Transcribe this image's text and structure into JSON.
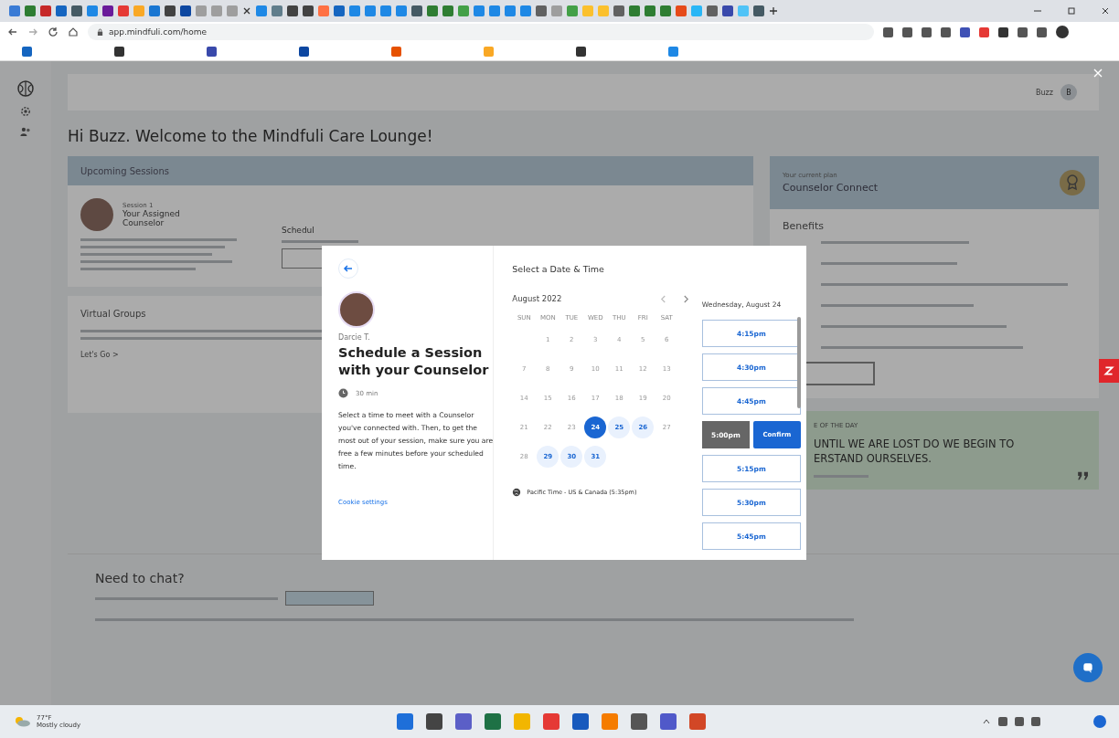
{
  "browser": {
    "address": "app.mindfuli.com/home"
  },
  "page": {
    "user": {
      "name": "Buzz",
      "initial": "B"
    },
    "greeting": "Hi Buzz. Welcome to the Mindfuli Care Lounge!",
    "upcoming": {
      "title": "Upcoming Sessions",
      "session_label": "Session 1",
      "counselor_title": "Your Assigned Counselor",
      "schedule_label": "Schedul"
    },
    "groups": {
      "title": "Virtual Groups",
      "link": "Let's Go >"
    },
    "plan": {
      "label": "Your current plan",
      "name": "Counselor Connect",
      "benefits_title": "Benefits"
    },
    "quote": {
      "label": "E OF THE DAY",
      "lines": [
        "UNTIL WE ARE LOST DO WE BEGIN TO",
        "ERSTAND OURSELVES."
      ]
    },
    "chat": {
      "title": "Need to chat?"
    }
  },
  "modal": {
    "counselor": "Darcie T.",
    "title": "Schedule a Session with your Counselor",
    "duration": "30 min",
    "description": "Select a time to meet with a Counselor you've connected with. Then, to get the most out of your session, make sure you are free a few minutes before your scheduled time.",
    "cookie_link": "Cookie settings",
    "heading": "Select a Date & Time",
    "month": "August 2022",
    "weekdays": [
      "SUN",
      "MON",
      "TUE",
      "WED",
      "THU",
      "FRI",
      "SAT"
    ],
    "weeks": [
      [
        {
          "day": "1",
          "available": false,
          "selected": false
        },
        {
          "day": "2",
          "available": false,
          "selected": false
        },
        {
          "day": "3",
          "available": false,
          "selected": false
        },
        {
          "day": "4",
          "available": false,
          "selected": false
        },
        {
          "day": "5",
          "available": false,
          "selected": false
        },
        {
          "day": "6",
          "available": false,
          "selected": false
        }
      ],
      [
        {
          "day": "7",
          "available": false,
          "selected": false
        },
        {
          "day": "8",
          "available": false,
          "selected": false
        },
        {
          "day": "9",
          "available": false,
          "selected": false
        },
        {
          "day": "10",
          "available": false,
          "selected": false
        },
        {
          "day": "11",
          "available": false,
          "selected": false
        },
        {
          "day": "12",
          "available": false,
          "selected": false
        },
        {
          "day": "13",
          "available": false,
          "selected": false
        }
      ],
      [
        {
          "day": "14",
          "available": false,
          "selected": false
        },
        {
          "day": "15",
          "available": false,
          "selected": false
        },
        {
          "day": "16",
          "available": false,
          "selected": false
        },
        {
          "day": "17",
          "available": false,
          "selected": false
        },
        {
          "day": "18",
          "available": false,
          "selected": false
        },
        {
          "day": "19",
          "available": false,
          "selected": false
        },
        {
          "day": "20",
          "available": false,
          "selected": false
        }
      ],
      [
        {
          "day": "21",
          "available": false,
          "selected": false
        },
        {
          "day": "22",
          "available": false,
          "selected": false
        },
        {
          "day": "23",
          "available": false,
          "selected": false
        },
        {
          "day": "24",
          "available": true,
          "selected": true
        },
        {
          "day": "25",
          "available": true,
          "selected": false
        },
        {
          "day": "26",
          "available": true,
          "selected": false
        },
        {
          "day": "27",
          "available": false,
          "selected": false
        }
      ],
      [
        {
          "day": "28",
          "available": false,
          "selected": false
        },
        {
          "day": "29",
          "available": true,
          "selected": false
        },
        {
          "day": "30",
          "available": true,
          "selected": false
        },
        {
          "day": "31",
          "available": true,
          "selected": false
        }
      ]
    ],
    "timezone": "Pacific Time - US & Canada (5:35pm)",
    "date_label": "Wednesday, August 24",
    "times": [
      {
        "label": "4:15pm",
        "selected": false
      },
      {
        "label": "4:30pm",
        "selected": false
      },
      {
        "label": "4:45pm",
        "selected": false
      },
      {
        "label": "5:00pm",
        "selected": true
      },
      {
        "label": "5:15pm",
        "selected": false
      },
      {
        "label": "5:30pm",
        "selected": false
      },
      {
        "label": "5:45pm",
        "selected": false
      }
    ],
    "confirm_label": "Confirm"
  },
  "taskbar": {
    "temperature": "77°F",
    "weather": "Mostly cloudy"
  }
}
